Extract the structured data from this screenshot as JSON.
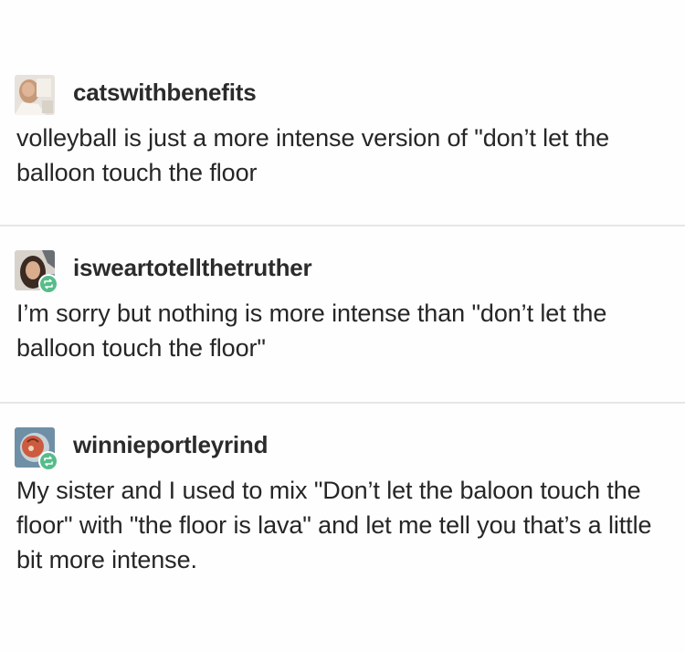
{
  "posts": [
    {
      "username": "catswithbenefits",
      "text": "volleyball is just a more intense version of \"don’t let the balloon touch the floor",
      "avatar": "user-photo",
      "reblog": false
    },
    {
      "username": "isweartotellthetruther",
      "text": "I’m sorry but nothing is more intense than \"don’t let the balloon touch the floor\"",
      "avatar": "user-photo",
      "reblog": true
    },
    {
      "username": "winnieportleyrind",
      "text": "My sister and I used to mix \"Don’t let the baloon touch the floor\" with \"the floor is lava\" and let me tell you that’s a little bit more intense.",
      "avatar": "user-illustration",
      "reblog": true
    }
  ],
  "colors": {
    "reblog_badge": "#56bc8a",
    "divider": "#e6e6e6",
    "text": "#262626"
  },
  "icons": {
    "reblog": "reblog-icon"
  }
}
